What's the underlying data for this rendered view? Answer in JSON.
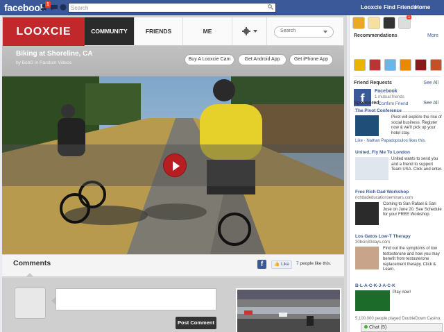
{
  "fb_bar": {
    "logo": "facebook",
    "notification_count": "1",
    "search_placeholder": "Search",
    "links": [
      "Looxcie",
      "Find Friends",
      "Home"
    ]
  },
  "app": {
    "logo": "LOOXCIE",
    "nav": [
      "COMMUNITY",
      "FRIENDS",
      "ME"
    ],
    "search_placeholder": "Search",
    "video_title": "Biking at Shoreline, CA",
    "video_subtitle": "by BobG in Random Videos",
    "buttons": [
      "Buy A Looxcie Cam",
      "Get Android App",
      "Get iPhone App"
    ],
    "comments_label": "Comments",
    "like_label": "Like",
    "like_count_num": "7",
    "like_count_text": " people like this.",
    "post_comment": "Post Comment"
  },
  "sidebar": {
    "recommendations": "Recommendations",
    "more": "More",
    "friend_requests": "Friend Requests",
    "see_all": "See All",
    "friend_name": "Facebook",
    "mutual": "1 mutual friends",
    "confirm": "Confirm Friend",
    "sponsored": "Sponsored",
    "ads": [
      {
        "title": "The Pivot Conference",
        "text": "Pivot will explore the rise of social business. Register now & we'll pick up your hotel stay.",
        "like": "Like · Nathan Papadopoulos likes this."
      },
      {
        "title": "United, Fly Me To London",
        "text": "United wants to send you and a friend to support Team USA. Click and enter."
      },
      {
        "title": "Free Rich Dad Workshop",
        "sub": "richdadeducationseminars.com",
        "text": "Coming to San Rafael & San Jose on June 20. See Schedule for your FREE Workshop."
      },
      {
        "title": "Los Gatos Low-T Therapy",
        "sub": "30bsin30days.com",
        "text": "Find out the symptoms of low testosterone and how you may benefit from testosterone replacement therapy. Click & Learn."
      },
      {
        "title": "B-L-A-C-K-J-A-C-K",
        "text": "Play now!",
        "sub": "5,100,000 people played DoubleDown Casino."
      }
    ],
    "chat": "Chat (5)"
  }
}
